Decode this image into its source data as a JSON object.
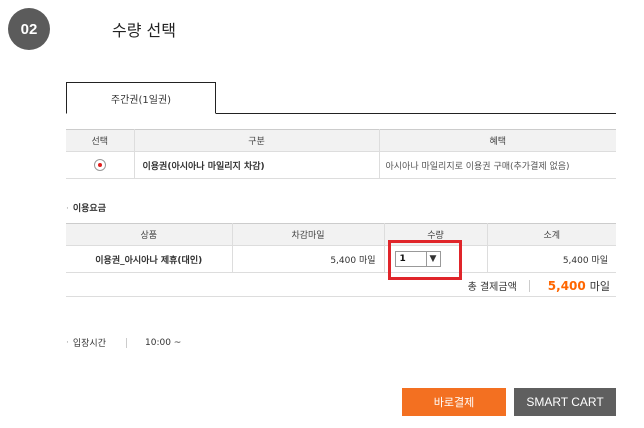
{
  "step": {
    "number": "02",
    "title": "수량 선택"
  },
  "tabs": [
    {
      "label": "주간권(1일권)"
    }
  ],
  "selection_table": {
    "headers": [
      "선택",
      "구분",
      "혜택"
    ],
    "rows": [
      {
        "type": "이용권(아시아나 마일리지 차감)",
        "benefit": "아시아나 마일리지로 이용권 구매(추가결제 없음)",
        "selected": true
      }
    ]
  },
  "fee_section": {
    "label": "이용요금"
  },
  "fee_table": {
    "headers": [
      "상품",
      "차감마일",
      "수량",
      "소계"
    ],
    "rows": [
      {
        "product": "이용권_아시아나 제휴(대인)",
        "miles": "5,400 마일",
        "quantity": "1",
        "subtotal": "5,400 마일"
      }
    ]
  },
  "total": {
    "label": "총 결제금액",
    "amount": "5,400",
    "unit": "마일"
  },
  "entry_time": {
    "label": "입장시간",
    "value": "10:00 ~"
  },
  "buttons": {
    "pay": "바로결제",
    "cart": "SMART CART"
  },
  "colors": {
    "accent": "#f37021",
    "highlight": "#e0252a",
    "total": "#ff6600",
    "cart": "#5f5f5f"
  }
}
